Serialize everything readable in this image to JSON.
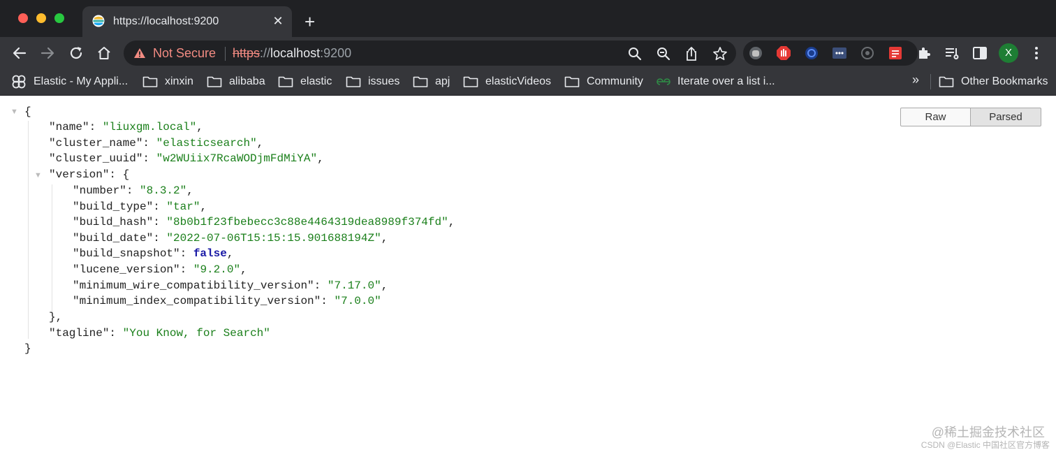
{
  "browser": {
    "tab": {
      "title": "https://localhost:9200",
      "close_glyph": "✕"
    },
    "new_tab_glyph": "+",
    "omnibox": {
      "security_label": "Not Secure",
      "url_scheme": "https",
      "url_separator": "://",
      "url_host": "localhost",
      "url_port": ":9200"
    },
    "profile_initial": "X",
    "bookmarks": [
      {
        "label": "Elastic - My Appli...",
        "icon": "elastic-icon"
      },
      {
        "label": "xinxin",
        "icon": "folder-icon"
      },
      {
        "label": "alibaba",
        "icon": "folder-icon"
      },
      {
        "label": "elastic",
        "icon": "folder-icon"
      },
      {
        "label": "issues",
        "icon": "folder-icon"
      },
      {
        "label": "apj",
        "icon": "folder-icon"
      },
      {
        "label": "elasticVideos",
        "icon": "folder-icon"
      },
      {
        "label": "Community",
        "icon": "folder-icon"
      },
      {
        "label": "Iterate over a list i...",
        "icon": "geeks-icon"
      }
    ],
    "bookmarks_overflow": "»",
    "other_bookmarks": "Other Bookmarks"
  },
  "viewer": {
    "toggle": {
      "raw_label": "Raw",
      "parsed_label": "Parsed",
      "selected": "Parsed"
    },
    "json": {
      "name": "liuxgm.local",
      "cluster_name": "elasticsearch",
      "cluster_uuid": "w2WUiix7RcaWODjmFdMiYA",
      "version": {
        "number": "8.3.2",
        "build_type": "tar",
        "build_hash": "8b0b1f23fbebecc3c88e4464319dea8989f374fd",
        "build_date": "2022-07-06T15:15:15.901688194Z",
        "build_snapshot": "false",
        "lucene_version": "9.2.0",
        "minimum_wire_compatibility_version": "7.17.0",
        "minimum_index_compatibility_version": "7.0.0"
      },
      "tagline": "You Know, for Search"
    }
  },
  "watermark": {
    "line1": "@稀土掘金技术社区",
    "line2": "CSDN @Elastic 中国社区官方博客"
  },
  "colors": {
    "tab_strip": "#202124",
    "toolbar": "#35363a",
    "not_secure": "#f28b82",
    "json_string": "#1a7f1a",
    "json_boolean": "#1a1aa6"
  }
}
